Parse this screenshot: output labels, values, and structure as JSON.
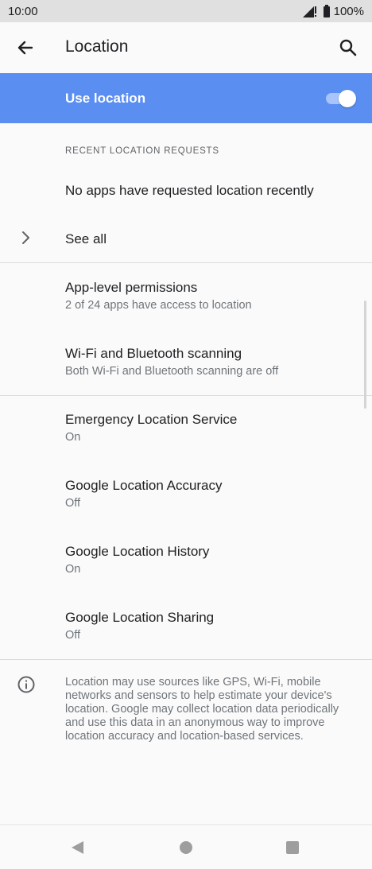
{
  "status_bar": {
    "time": "10:00",
    "battery": "100%"
  },
  "app_bar": {
    "title": "Location"
  },
  "use_location": {
    "label": "Use location",
    "enabled": true,
    "color": "#5a8ef1"
  },
  "recent": {
    "header": "RECENT LOCATION REQUESTS",
    "empty_text": "No apps have requested location recently",
    "see_all": "See all"
  },
  "items": [
    {
      "title": "App-level permissions",
      "subtitle": "2 of 24 apps have access to location"
    },
    {
      "title": "Wi-Fi and Bluetooth scanning",
      "subtitle": "Both Wi-Fi and Bluetooth scanning are off"
    },
    {
      "title": "Emergency Location Service",
      "subtitle": "On"
    },
    {
      "title": "Google Location Accuracy",
      "subtitle": "Off"
    },
    {
      "title": "Google Location History",
      "subtitle": "On"
    },
    {
      "title": "Google Location Sharing",
      "subtitle": "Off"
    }
  ],
  "footer_info": "Location may use sources like GPS, Wi-Fi, mobile networks and sensors to help estimate your device's location. Google may collect location data periodically and use this data in an anonymous way to improve location accuracy and location-based services."
}
